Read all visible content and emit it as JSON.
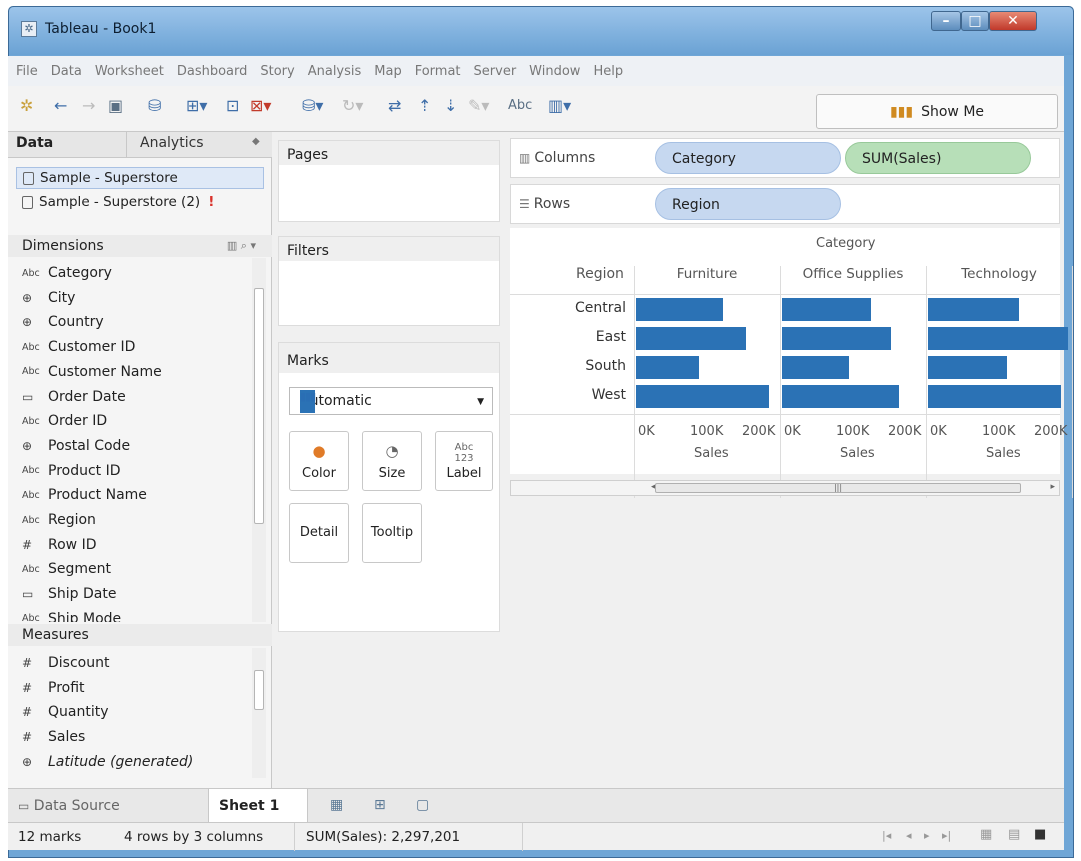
{
  "window": {
    "title": "Tableau - Book1",
    "controls": [
      "–",
      "□",
      "✕"
    ]
  },
  "menu": [
    "File",
    "Data",
    "Worksheet",
    "Dashboard",
    "Story",
    "Analysis",
    "Map",
    "Format",
    "Server",
    "Window",
    "Help"
  ],
  "toolbar": {
    "show_me": "Show Me",
    "abc_label": "Abc"
  },
  "left_panel": {
    "tabs": {
      "data": "Data",
      "analytics": "Analytics"
    },
    "data_sources": [
      "Sample - Superstore",
      "Sample - Superstore (2)"
    ],
    "warning_mark": "!",
    "dimensions_header": "Dimensions",
    "dimensions": [
      {
        "type": "Abc",
        "name": "Category"
      },
      {
        "type": "geo",
        "name": "City"
      },
      {
        "type": "geo",
        "name": "Country"
      },
      {
        "type": "Abc",
        "name": "Customer ID"
      },
      {
        "type": "Abc",
        "name": "Customer Name"
      },
      {
        "type": "date",
        "name": "Order Date"
      },
      {
        "type": "Abc",
        "name": "Order ID"
      },
      {
        "type": "geo",
        "name": "Postal Code"
      },
      {
        "type": "Abc",
        "name": "Product ID"
      },
      {
        "type": "Abc",
        "name": "Product Name"
      },
      {
        "type": "Abc",
        "name": "Region"
      },
      {
        "type": "num",
        "name": "Row ID"
      },
      {
        "type": "Abc",
        "name": "Segment"
      },
      {
        "type": "date",
        "name": "Ship Date"
      },
      {
        "type": "Abc",
        "name": "Ship Mode"
      }
    ],
    "measures_header": "Measures",
    "measures": [
      {
        "type": "num",
        "name": "Discount"
      },
      {
        "type": "num",
        "name": "Profit"
      },
      {
        "type": "num",
        "name": "Quantity"
      },
      {
        "type": "num",
        "name": "Sales"
      },
      {
        "type": "geo",
        "name": "Latitude (generated)"
      }
    ]
  },
  "cards": {
    "pages": "Pages",
    "filters": "Filters",
    "marks": "Marks",
    "mark_type": "Automatic",
    "buttons": {
      "color": "Color",
      "size": "Size",
      "label": "Label",
      "detail": "Detail",
      "tooltip": "Tooltip"
    }
  },
  "shelves": {
    "columns_label": "Columns",
    "rows_label": "Rows",
    "columns_pills": [
      "Category",
      "SUM(Sales)"
    ],
    "rows_pills": [
      "Region"
    ]
  },
  "chart_data": {
    "type": "bar",
    "column_header": "Category",
    "row_header": "Region",
    "categories": [
      "Central",
      "East",
      "South",
      "West"
    ],
    "panels": [
      {
        "name": "Furniture",
        "values": [
          163797,
          208291,
          117299,
          252613
        ]
      },
      {
        "name": "Office Supplies",
        "values": [
          167026,
          205516,
          125651,
          220853
        ]
      },
      {
        "name": "Technology",
        "values": [
          170416,
          264974,
          148772,
          251992
        ]
      }
    ],
    "xlim": [
      0,
      250000
    ],
    "x_ticks": [
      "0K",
      "100K",
      "200K"
    ],
    "xlabel": "Sales",
    "bar_color": "#2b72b5"
  },
  "sheet_bar": {
    "data_source": "Data Source",
    "sheet": "Sheet 1"
  },
  "status": {
    "marks": "12 marks",
    "dims": "4 rows by 3 columns",
    "sum": "SUM(Sales): 2,297,201"
  }
}
